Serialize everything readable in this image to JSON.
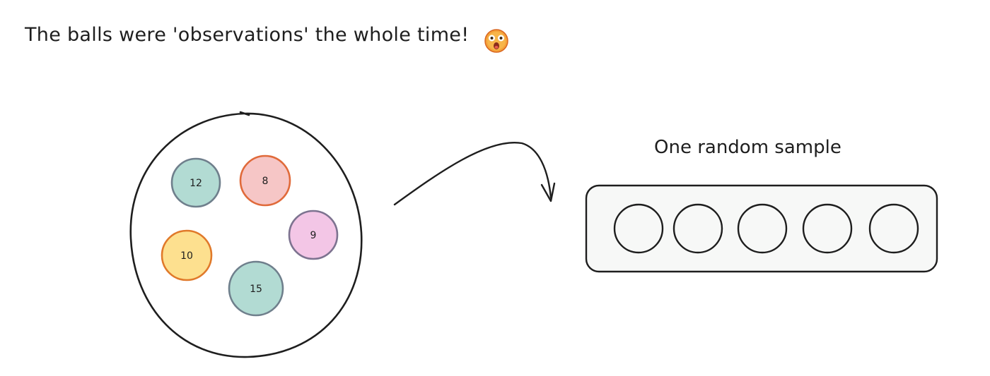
{
  "title": "The balls were 'observations' the whole time!",
  "emoji": "astonished-face",
  "sample_label": "One random sample",
  "urn": {
    "balls": [
      {
        "label": "12",
        "fill": "#b2dbd3",
        "stroke": "#6f7f8c"
      },
      {
        "label": "8",
        "fill": "#f6c6c6",
        "stroke": "#e06a3a"
      },
      {
        "label": "9",
        "fill": "#f3c6e6",
        "stroke": "#7d7390"
      },
      {
        "label": "10",
        "fill": "#fde08f",
        "stroke": "#e0792a"
      },
      {
        "label": "15",
        "fill": "#b2dbd3",
        "stroke": "#6f7f8c"
      }
    ]
  },
  "sample": {
    "slot_count": 5,
    "tray_fill": "#f7f8f7"
  },
  "colors": {
    "ink": "#1e1e1e",
    "accent_orange": "#e0792a",
    "teal": "#b2dbd3"
  }
}
